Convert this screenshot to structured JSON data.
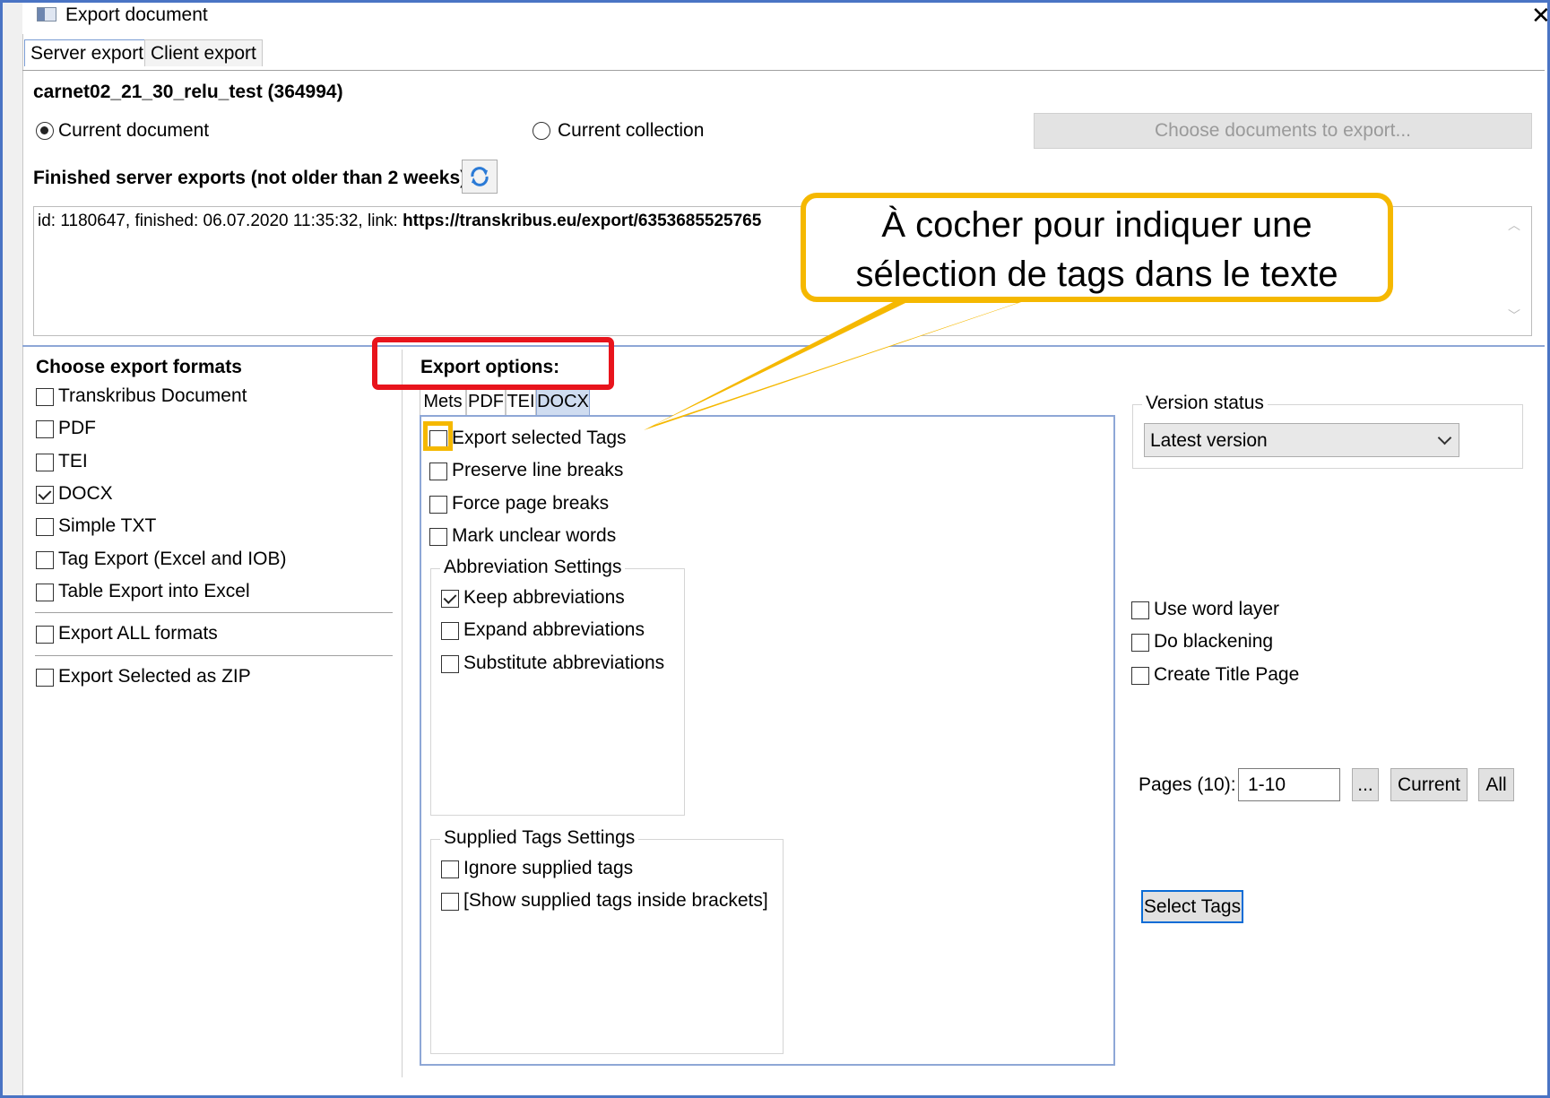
{
  "window": {
    "title": "Export document",
    "close_glyph": "✕"
  },
  "tabs": {
    "server": "Server export",
    "client": "Client export"
  },
  "document_name": "carnet02_21_30_relu_test (364994)",
  "scope": {
    "current_document": "Current document",
    "current_collection": "Current collection",
    "choose_docs": "Choose documents to export..."
  },
  "finished_exports": {
    "title": "Finished server exports (not older than 2 weeks)",
    "entry_prefix": "id: 1180647, finished: 06.07.2020 11:35:32, link: ",
    "entry_link": "https://transkribus.eu/export/6353685525765"
  },
  "formats": {
    "title": "Choose export formats",
    "items": [
      "Transkribus Document",
      "PDF",
      "TEI",
      "DOCX",
      "Simple TXT",
      "Tag Export (Excel and IOB)",
      "Table Export into Excel"
    ],
    "checked": [
      false,
      false,
      false,
      true,
      false,
      false,
      false
    ],
    "all": "Export ALL formats",
    "zip": "Export Selected as ZIP"
  },
  "options": {
    "title": "Export options:",
    "tabs": [
      "Mets",
      "PDF",
      "TEI",
      "DOCX"
    ],
    "items": [
      "Export selected Tags",
      "Preserve line breaks",
      "Force page breaks",
      "Mark unclear words"
    ],
    "abbr_title": "Abbreviation Settings",
    "abbr": [
      "Keep abbreviations",
      "Expand abbreviations",
      "Substitute abbreviations"
    ],
    "supplied_title": "Supplied Tags Settings",
    "supplied": [
      "Ignore supplied tags",
      "[Show supplied tags inside brackets]"
    ]
  },
  "right": {
    "version_title": "Version status",
    "version_value": "Latest version",
    "checks": [
      "Use word layer",
      "Do blackening",
      "Create Title Page"
    ],
    "pages_label": "Pages (10):",
    "pages_value": "1-10",
    "dots": "...",
    "current": "Current",
    "all": "All",
    "select_tags": "Select Tags"
  },
  "callout": {
    "line1": "À cocher pour indiquer une",
    "line2": "sélection de tags dans le texte"
  },
  "colors": {
    "frame": "#4a74c4",
    "callout": "#f5b800",
    "highlight": "#e8141c"
  }
}
